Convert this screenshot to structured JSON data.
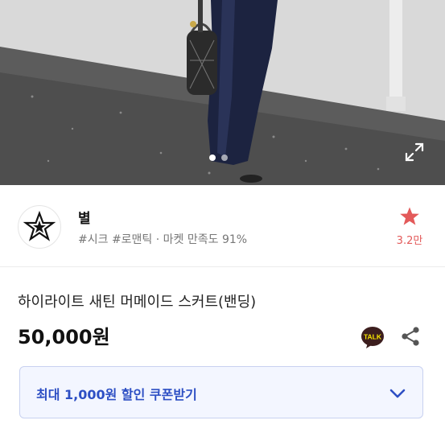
{
  "gallery": {
    "slide_count": 2,
    "active_slide": 1
  },
  "shop": {
    "name": "별",
    "tags": "#시크 #로맨틱 · 마켓 만족도 91%",
    "favorite_count": "3.2만"
  },
  "product": {
    "name": "하이라이트 새틴 머메이드 스커트(밴딩)",
    "price": "50,000원"
  },
  "talk": {
    "label": "TALK"
  },
  "coupon": {
    "label": "최대 1,000원 할인 쿠폰받기"
  },
  "colors": {
    "accent_blue": "#2d4fc4",
    "coupon_bg": "#f3f6ff",
    "favorite_red": "#e35a5a",
    "talk_yellow": "#3c1e1e"
  }
}
